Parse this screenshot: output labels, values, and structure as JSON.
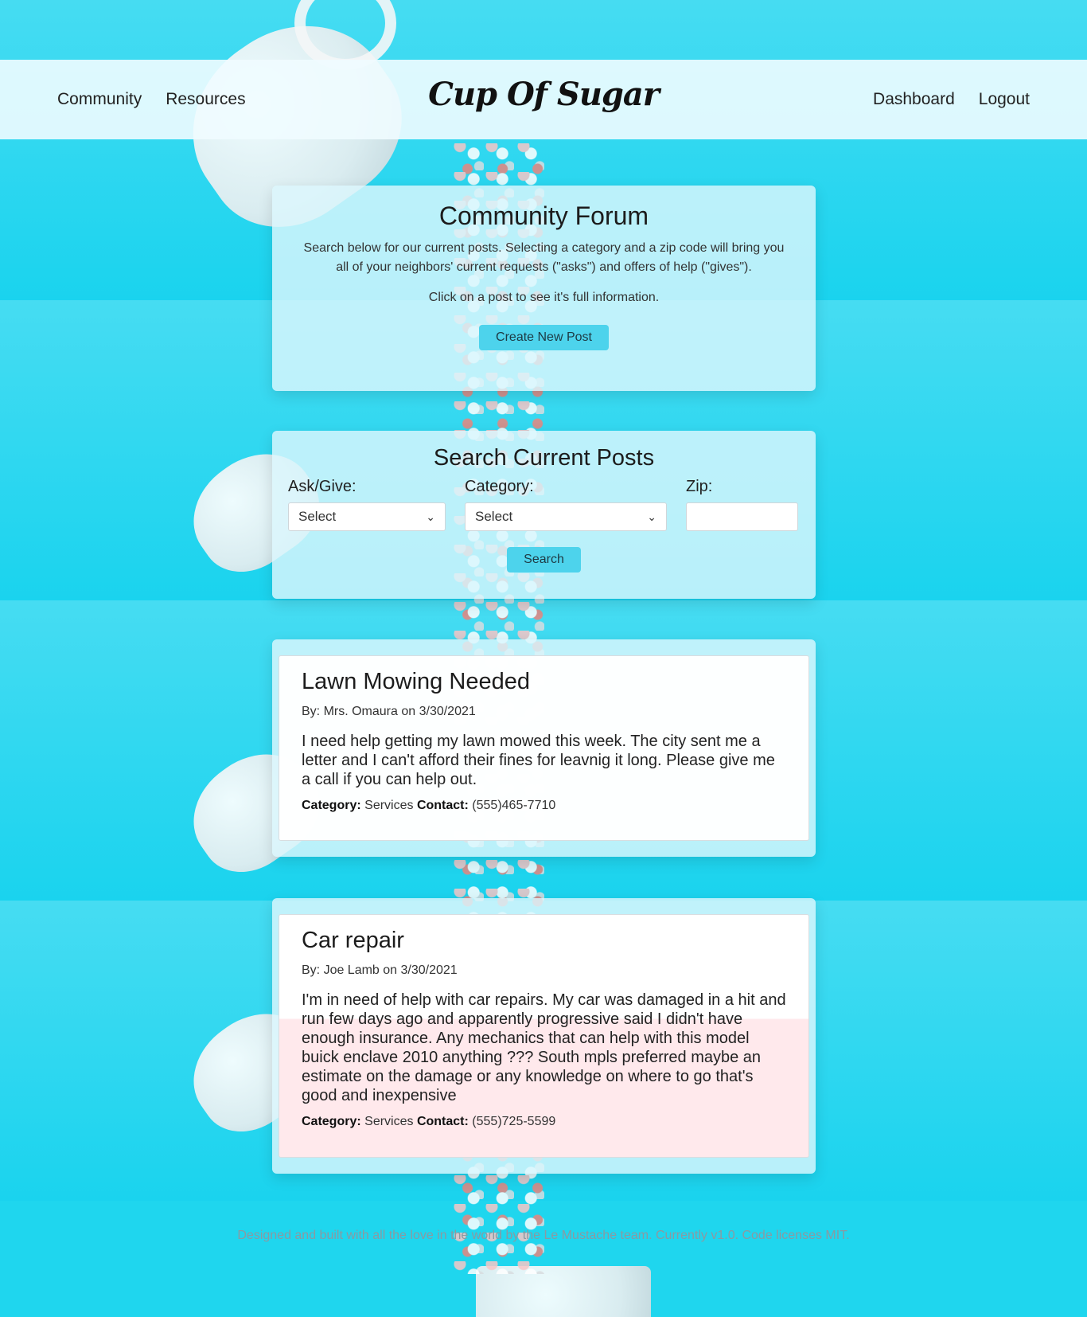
{
  "header": {
    "brand": "Cup Of Sugar",
    "nav_left": [
      {
        "label": "Community"
      },
      {
        "label": "Resources"
      }
    ],
    "nav_right": [
      {
        "label": "Dashboard"
      },
      {
        "label": "Logout"
      }
    ]
  },
  "forum": {
    "title": "Community Forum",
    "description": "Search below for our current posts. Selecting a category and a zip code will bring you all of your neighbors' current requests (\"asks\") and offers of help (\"gives\").",
    "hint": "Click on a post to see it's full information.",
    "create_button": "Create New Post"
  },
  "search": {
    "title": "Search Current Posts",
    "ask_give": {
      "label": "Ask/Give:",
      "value": "Select"
    },
    "category": {
      "label": "Category:",
      "value": "Select"
    },
    "zip": {
      "label": "Zip:",
      "value": ""
    },
    "button": "Search"
  },
  "posts": [
    {
      "title": "Lawn Mowing Needed",
      "byline": "By: Mrs. Omaura on 3/30/2021",
      "body": "I need help getting my lawn mowed this week. The city sent me a letter and I can't afford their fines for leavnig it long. Please give me a call if you can help out.",
      "category_label": "Category:",
      "category": "Services",
      "contact_label": "Contact:",
      "contact": "(555)465-7710"
    },
    {
      "title": "Car repair",
      "byline": "By: Joe Lamb on 3/30/2021",
      "body": "I'm in need of help with car repairs. My car was damaged in a hit and run few days ago and apparently progressive said I didn't have enough insurance. Any mechanics that can help with this model buick enclave 2010 anything ??? South mpls preferred maybe an estimate on the damage or any knowledge on where to go that's good and inexpensive",
      "category_label": "Category:",
      "category": "Services",
      "contact_label": "Contact:",
      "contact": "(555)725-5599"
    }
  ],
  "footer": {
    "text": "Designed and built with all the love in the world by the Le Mustache team. Currently v1.0. Code licenses MIT."
  },
  "colors": {
    "background": "#1fd6ee",
    "button": "#4dd3ec",
    "card": "#dcf6fc"
  }
}
